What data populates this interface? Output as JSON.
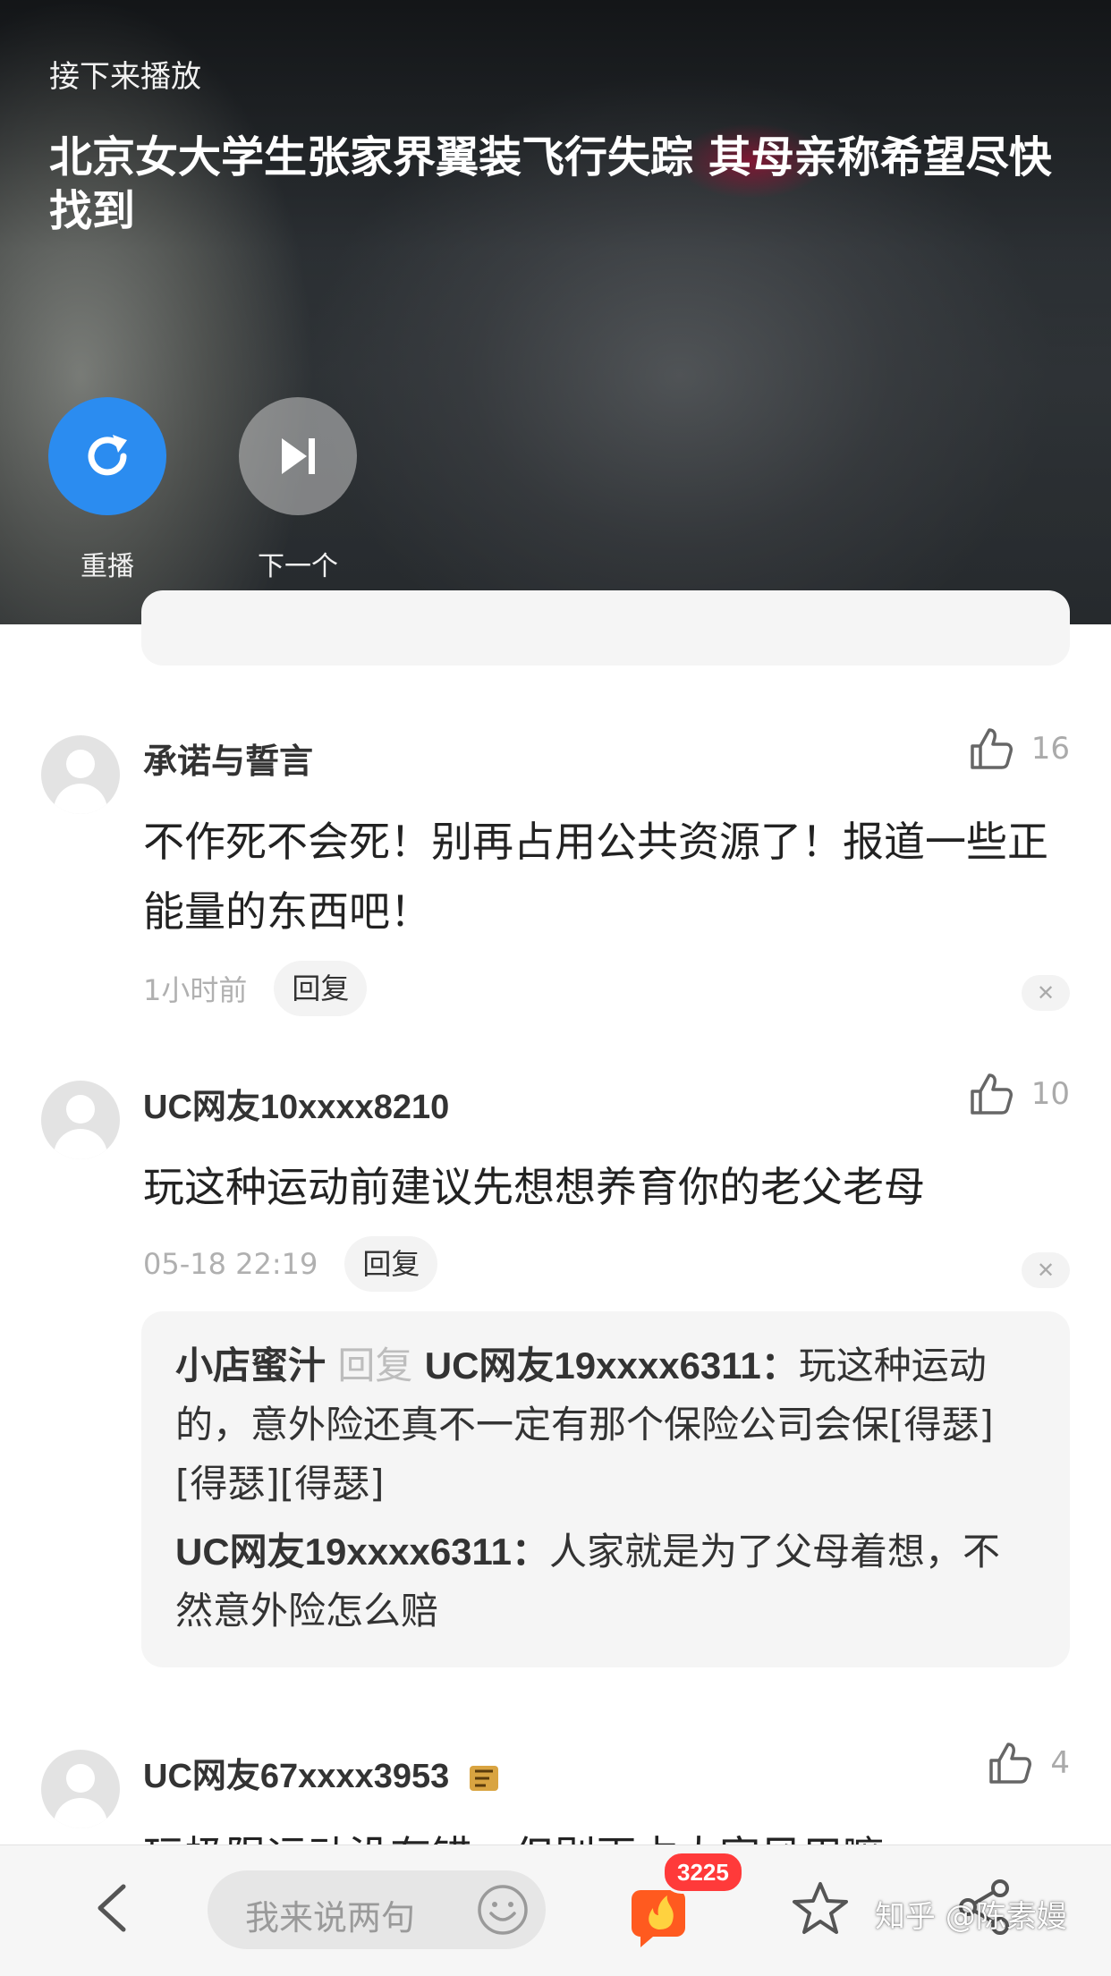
{
  "video": {
    "next_label": "接下来播放",
    "next_title": "北京女大学生张家界翼装飞行失踪 其母亲称希望尽快找到",
    "replay_label": "重播",
    "skip_label": "下一个"
  },
  "comments": [
    {
      "user": "承诺与誓言",
      "likes": "16",
      "text": "不作死不会死！别再占用公共资源了！报道一些正能量的东西吧！",
      "time": "1小时前",
      "reply_label": "回复"
    },
    {
      "user": "UC网友10xxxx8210",
      "likes": "10",
      "text": "玩这种运动前建议先想想养育你的老父老母",
      "time": "05-18 22:19",
      "reply_label": "回复",
      "replies": {
        "r1_user": "小店蜜汁",
        "r1_reply_word": "回复",
        "r1_target": "UC网友19xxxx6311：",
        "r1_text": "玩这种运动的，意外险还真不一定有那个保险公司会保[得瑟][得瑟][得瑟]",
        "r2_user": "UC网友19xxxx6311：",
        "r2_text": "人家就是为了父母着想，不然意外险怎么赔"
      }
    },
    {
      "user": "UC网友67xxxx3953",
      "likes": "4",
      "text": "玩极限运动没有错，但别再占大家风用嘛"
    }
  ],
  "bottom_bar": {
    "input_placeholder": "我来说两句",
    "fire_badge": "3225",
    "watermark": "知乎 @陈素嫚"
  },
  "colors": {
    "replay_blue": "#2b8cf0",
    "badge_red": "#ff3a3a",
    "fire_orange": "#ff5a1f"
  },
  "icons": [
    "replay-icon",
    "skip-next-icon",
    "thumbs-up-icon",
    "close-icon",
    "back-chevron-icon",
    "emoji-icon",
    "fire-icon",
    "star-icon",
    "share-icon",
    "medal-icon"
  ]
}
